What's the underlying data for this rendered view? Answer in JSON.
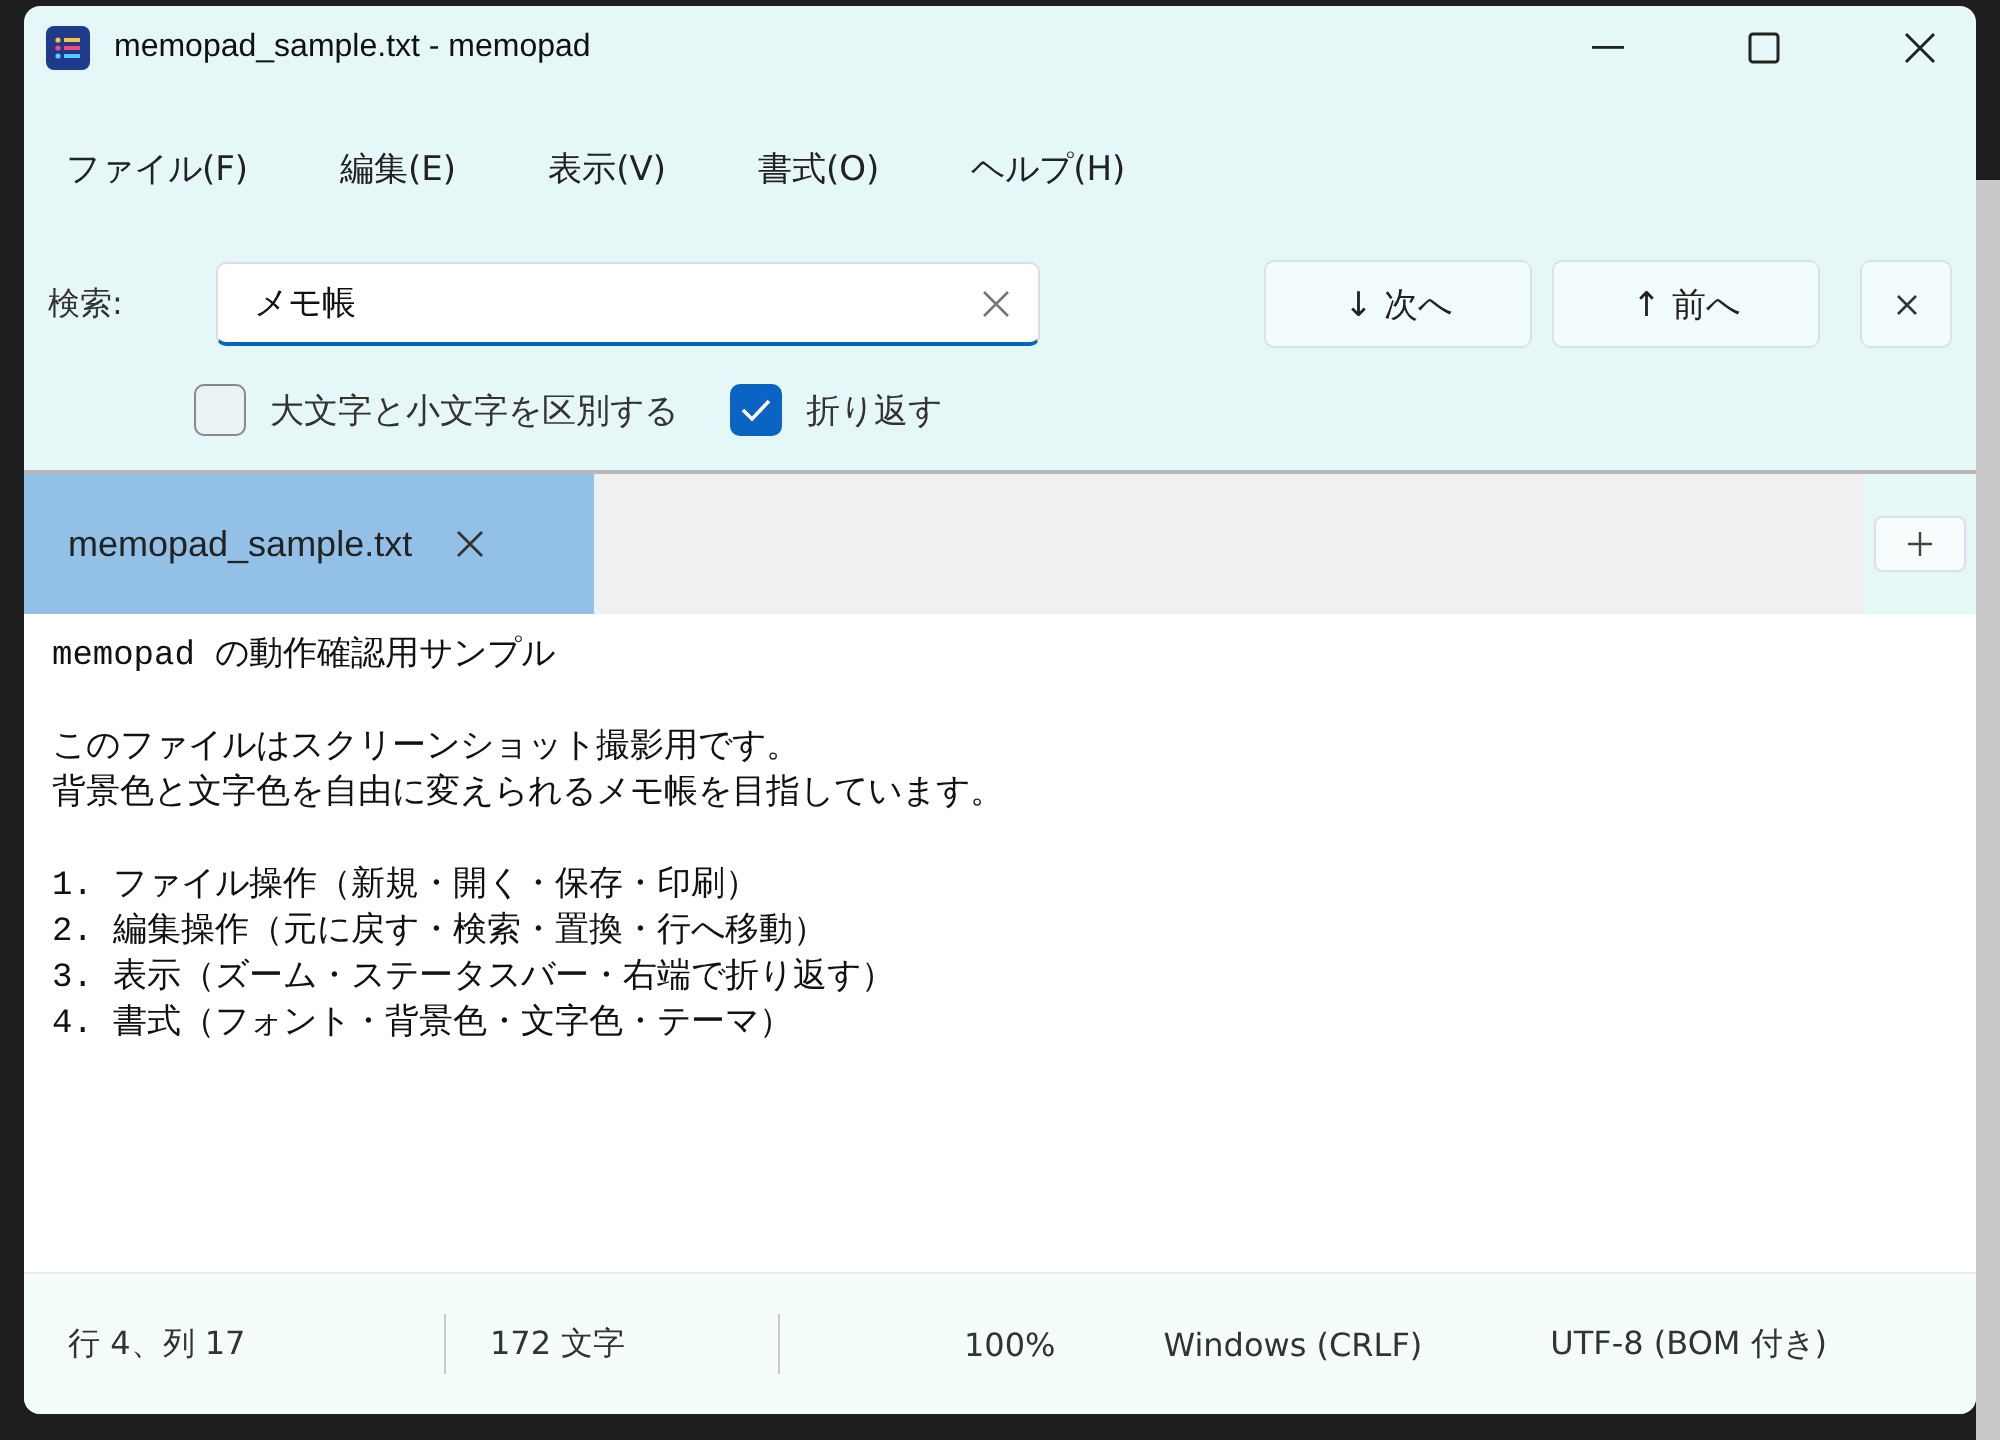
{
  "window": {
    "title": "memopad_sample.txt - memopad"
  },
  "menu": [
    {
      "label": "ファイル(F)"
    },
    {
      "label": "編集(E)"
    },
    {
      "label": "表示(V)"
    },
    {
      "label": "書式(O)"
    },
    {
      "label": "ヘルプ(H)"
    }
  ],
  "search": {
    "label": "検索:",
    "value": "メモ帳",
    "next": "↓ 次へ",
    "prev": "↑ 前へ",
    "options": [
      {
        "label": "大文字と小文字を区別する",
        "checked": false
      },
      {
        "label": "折り返す",
        "checked": true
      }
    ]
  },
  "tabs": [
    {
      "label": "memopad_sample.txt",
      "selected": true
    }
  ],
  "editor": {
    "paragraphs": [
      [
        "memopad の動作確認用サンプル"
      ],
      [
        "このファイルはスクリーンショット撮影用です。",
        "背景色と文字色を自由に変えられるメモ帳を目指しています。"
      ],
      [
        "1. ファイル操作（新規・開く・保存・印刷）",
        "2. 編集操作（元に戻す・検索・置換・行へ移動）",
        "3. 表示（ズーム・ステータスバー・右端で折り返す）",
        "4. 書式（フォント・背景色・文字色・テーマ）"
      ]
    ]
  },
  "status_bar": [
    {
      "text": "行 4、列 17"
    },
    {
      "text": "172 文字"
    },
    {
      "text": "100%"
    },
    {
      "text": "Windows (CRLF)"
    },
    {
      "text": "UTF-8 (BOM 付き)"
    }
  ]
}
